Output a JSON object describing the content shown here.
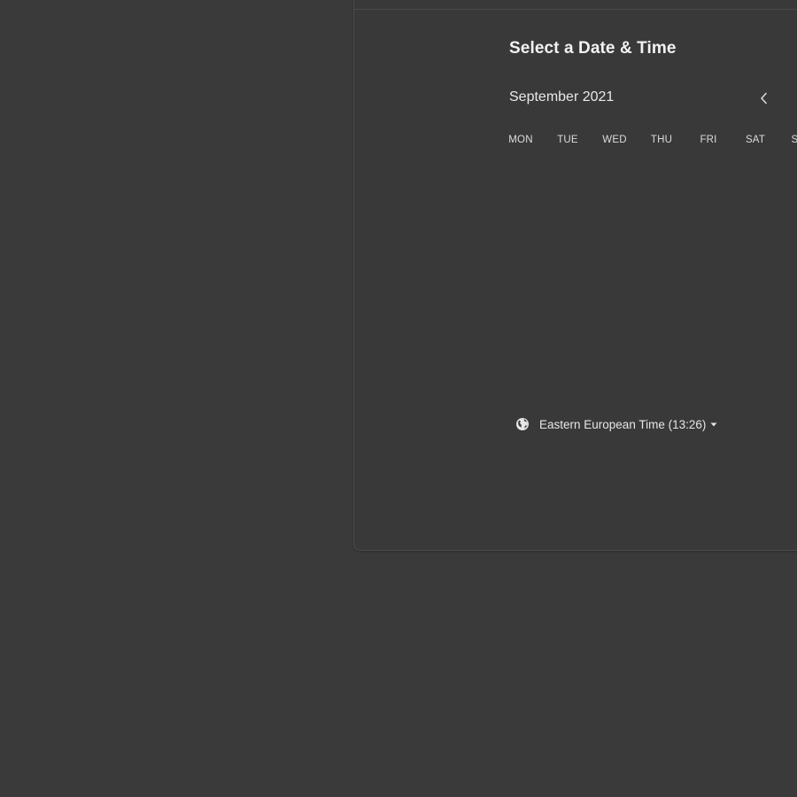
{
  "scheduler": {
    "title": "Select a Date & Time",
    "month": "September 2021",
    "nav": {
      "prev_icon": "chevron-left-icon"
    },
    "weekdays": [
      "MON",
      "TUE",
      "WED",
      "THU",
      "FRI",
      "SAT",
      "SUN"
    ],
    "timezone": {
      "icon": "globe-icon",
      "label": "Eastern European Time (13:26)",
      "dropdown_icon": "caret-down-icon"
    }
  },
  "colors": {
    "background": "#3a3a3a",
    "card": "#393939",
    "text": "#f2f2f2"
  }
}
